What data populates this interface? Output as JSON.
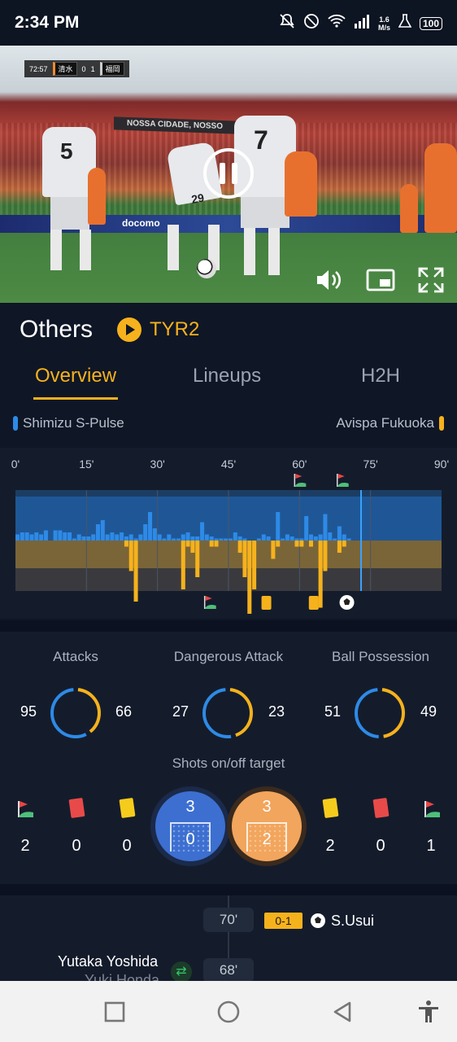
{
  "status_bar": {
    "time": "2:34 PM",
    "speed_value": "1.6",
    "speed_unit": "M/s",
    "battery": "100"
  },
  "video": {
    "clock": "72:57",
    "home_abbr": "清水",
    "home_score": "0",
    "away_score": "1",
    "away_abbr": "福岡",
    "banner_text": "NOSSA CIDADE, NOSSO",
    "sponsor": "docomo",
    "jersey_home": "5",
    "jersey_home2": "7",
    "jersey_home3": "29"
  },
  "header": {
    "league": "Others",
    "tournament": "TYR2"
  },
  "tabs": [
    "Overview",
    "Lineups",
    "H2H"
  ],
  "teams": {
    "home": "Shimizu S-Pulse",
    "away": "Avispa Fukuoka",
    "home_color": "#2e8ae6",
    "away_color": "#f6b21c"
  },
  "chart_data": {
    "type": "bar",
    "x_ticks": [
      "0'",
      "15'",
      "30'",
      "45'",
      "60'",
      "75'",
      "90'"
    ],
    "xlim": [
      0,
      90
    ],
    "current_minute": 73,
    "home_attack": [
      3,
      4,
      4,
      3,
      4,
      3,
      5,
      0,
      5,
      5,
      4,
      4,
      1,
      3,
      2,
      2,
      3,
      8,
      10,
      3,
      4,
      3,
      4,
      2,
      3,
      1,
      3,
      8,
      14,
      6,
      3,
      1,
      3,
      1,
      1,
      3,
      4,
      2,
      2,
      9,
      3,
      2,
      1,
      1,
      1,
      1,
      4,
      2,
      1,
      0,
      0,
      1,
      3,
      2,
      0,
      14,
      1,
      3,
      2,
      1,
      1,
      12,
      3,
      2,
      3,
      13,
      4,
      1,
      7,
      3,
      1,
      0,
      0
    ],
    "away_attack": [
      0,
      0,
      0,
      0,
      0,
      0,
      0,
      0,
      0,
      0,
      0,
      0,
      0,
      0,
      0,
      0,
      0,
      0,
      0,
      0,
      0,
      0,
      0,
      -1,
      -5,
      -10,
      0,
      0,
      0,
      0,
      0,
      0,
      0,
      0,
      0,
      -8,
      -1,
      -2,
      -6,
      0,
      0,
      -1,
      -1,
      0,
      0,
      0,
      0,
      -2,
      -6,
      -12,
      -8,
      0,
      0,
      0,
      -3,
      -1,
      0,
      0,
      0,
      -1,
      -1,
      0,
      -1,
      0,
      -11,
      -5,
      0,
      0,
      -2,
      -1,
      0,
      0
    ],
    "home_events": [
      {
        "minute": 60,
        "type": "corner"
      },
      {
        "minute": 69,
        "type": "corner"
      }
    ],
    "away_events": [
      {
        "minute": 41,
        "type": "corner"
      },
      {
        "minute": 53,
        "type": "yellow"
      },
      {
        "minute": 63,
        "type": "yellow"
      },
      {
        "minute": 70,
        "type": "goal"
      }
    ]
  },
  "stats": {
    "attacks": {
      "label": "Attacks",
      "home": 95,
      "away": 66
    },
    "dangerous": {
      "label": "Dangerous Attack",
      "home": 27,
      "away": 23
    },
    "possession": {
      "label": "Ball Possession",
      "home": 51,
      "away": 49
    },
    "shots_label": "Shots on/off target",
    "home": {
      "corners": "2",
      "red": "0",
      "yellow": "0",
      "shots_on": "3",
      "shots_off": "0"
    },
    "away": {
      "corners": "1",
      "red": "0",
      "yellow": "2",
      "shots_on": "3",
      "shots_off": "2"
    }
  },
  "events": [
    {
      "minute": "70'",
      "score": "0-1",
      "player": "S.Usui",
      "type": "goal",
      "side": "away"
    },
    {
      "minute": "68'",
      "player_in": "Yutaka Yoshida",
      "player_out": "Yuki Honda",
      "type": "substitution",
      "side": "home"
    }
  ]
}
